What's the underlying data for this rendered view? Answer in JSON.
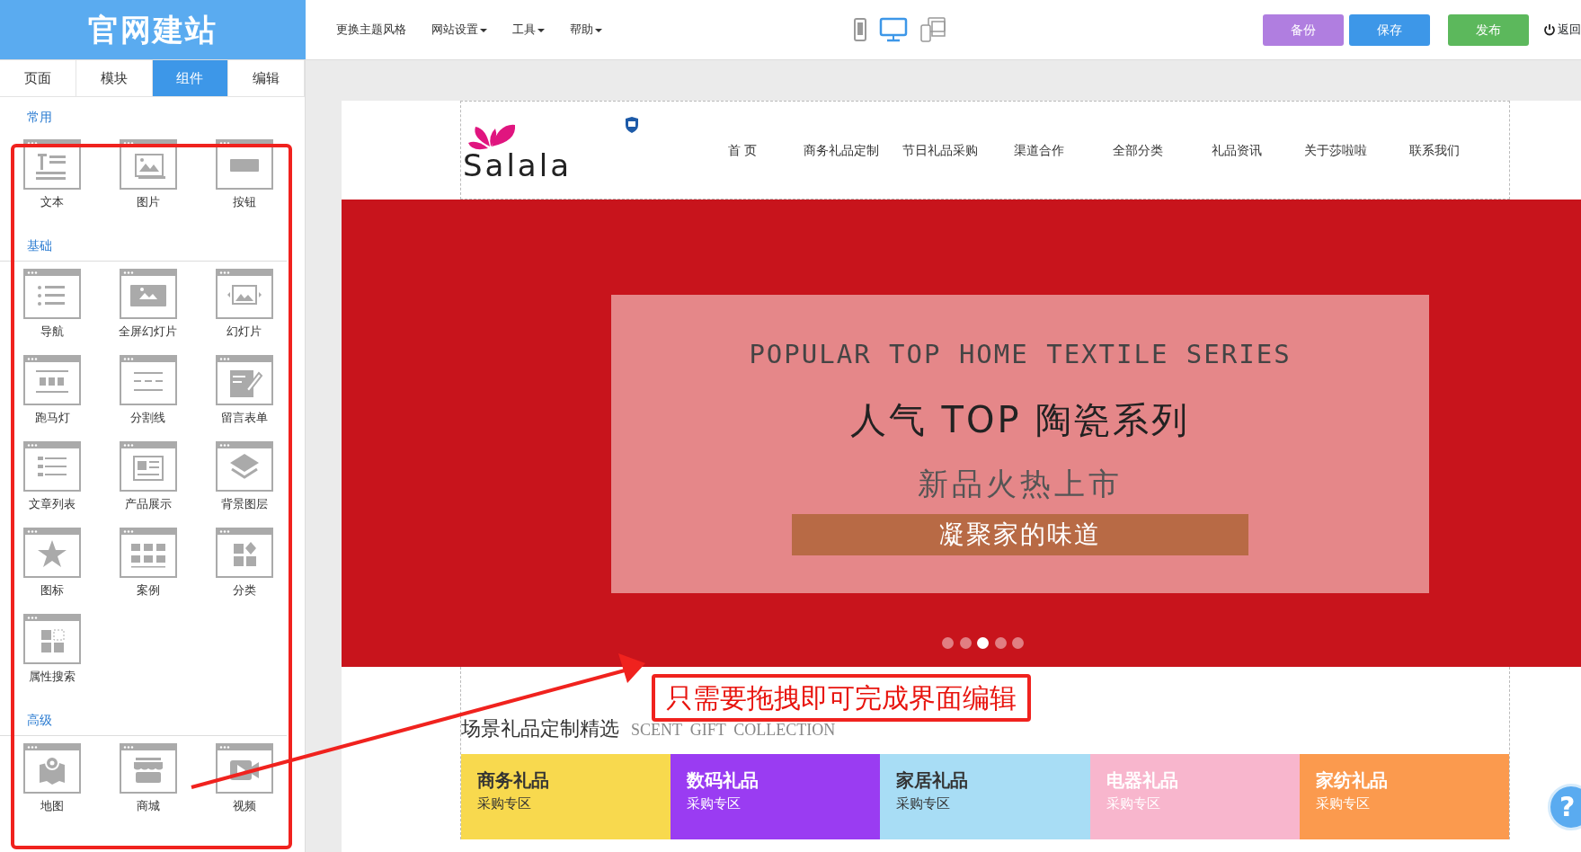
{
  "app_title": "官网建站",
  "menu": [
    {
      "label": "更换主题风格",
      "dropdown": false
    },
    {
      "label": "网站设置",
      "dropdown": true
    },
    {
      "label": "工具",
      "dropdown": true
    },
    {
      "label": "帮助",
      "dropdown": true
    }
  ],
  "devices": [
    {
      "selected": false
    },
    {
      "selected": true
    },
    {
      "selected": false
    }
  ],
  "actions": [
    {
      "label": "备份",
      "color": "#b07ee0"
    },
    {
      "label": "保存",
      "color": "#3d97e8"
    },
    {
      "label": "发布",
      "color": "#5cb85c"
    }
  ],
  "exit": "返回",
  "sidebar": {
    "tabs": [
      {
        "label": "页面",
        "selected": false
      },
      {
        "label": "模块",
        "selected": false
      },
      {
        "label": "组件",
        "selected": true
      },
      {
        "label": "编辑",
        "selected": false
      }
    ],
    "groups": [
      {
        "title": "常用",
        "items": [
          "文本",
          "图片",
          "按钮"
        ]
      },
      {
        "title": "基础",
        "items": [
          "导航",
          "全屏幻灯片",
          "幻灯片",
          "跑马灯",
          "分割线",
          "留言表单",
          "文章列表",
          "产品展示",
          "背景图层",
          "图标",
          "案例",
          "分类",
          "属性搜索"
        ]
      },
      {
        "title": "高级",
        "items": [
          "地图",
          "商城",
          "视频"
        ]
      }
    ]
  },
  "site": {
    "logo": "Salala",
    "nav": [
      "首 页",
      "商务礼品定制",
      "节日礼品采购",
      "渠道合作",
      "全部分类",
      "礼品资讯",
      "关于莎啦啦",
      "联系我们"
    ],
    "banner": {
      "subtitle": "POPULAR TOP HOME TEXTILE SERIES",
      "title": "人气 TOP 陶瓷系列",
      "tagline": "新品火热上市",
      "slogan": "凝聚家的味道",
      "dots": [
        {
          "selected": false
        },
        {
          "selected": false
        },
        {
          "selected": true
        },
        {
          "selected": false
        },
        {
          "selected": false
        }
      ]
    },
    "section": {
      "title": "场景礼品定制精选",
      "subtitle": "SCENT  GIFT  COLLECTION"
    },
    "categories": [
      {
        "title": "商务礼品",
        "subtitle": "采购专区",
        "color": "#f8d94e"
      },
      {
        "title": "数码礼品",
        "subtitle": "采购专区",
        "color": "#9a3cf2"
      },
      {
        "title": "家居礼品",
        "subtitle": "采购专区",
        "color": "#a8ddf5"
      },
      {
        "title": "电器礼品",
        "subtitle": "采购专区",
        "color": "#f8b6cd"
      },
      {
        "title": "家纺礼品",
        "subtitle": "采购专区",
        "color": "#fb9a4e"
      }
    ]
  },
  "annotation": "只需要拖拽即可完成界面编辑",
  "help": "?"
}
